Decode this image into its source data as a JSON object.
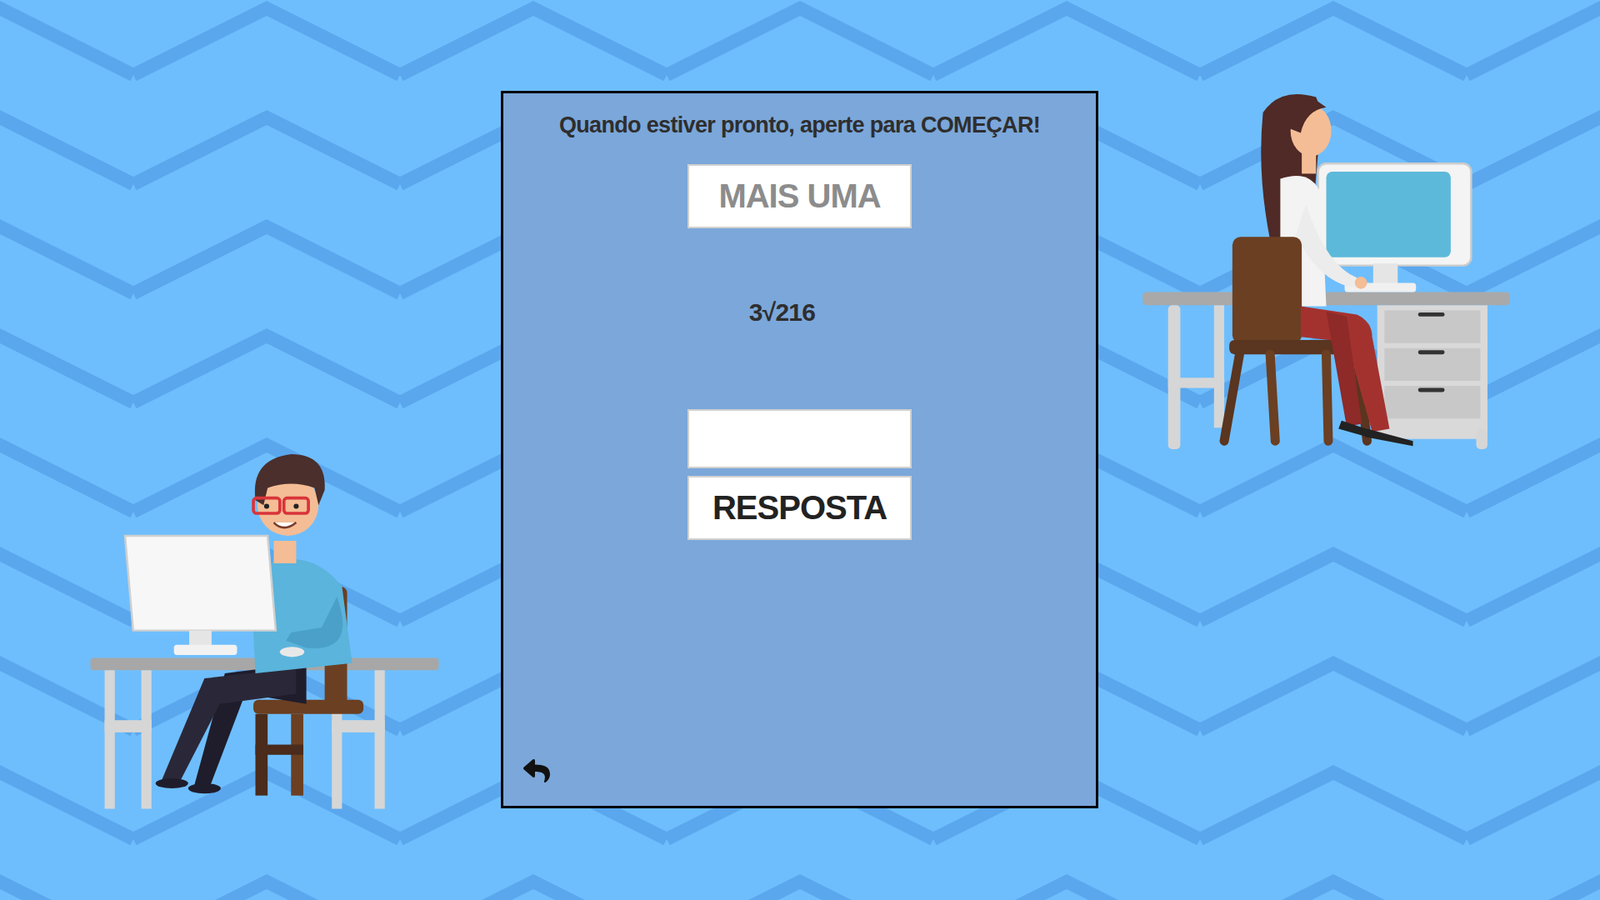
{
  "prompt": "Quando estiver pronto, aperte para COMEÇAR!",
  "more_button": {
    "label": "MAIS UMA",
    "disabled": true
  },
  "question": "3√216",
  "answer_field": {
    "value": ""
  },
  "answer_button": {
    "label": "RESPOSTA",
    "disabled": false
  }
}
